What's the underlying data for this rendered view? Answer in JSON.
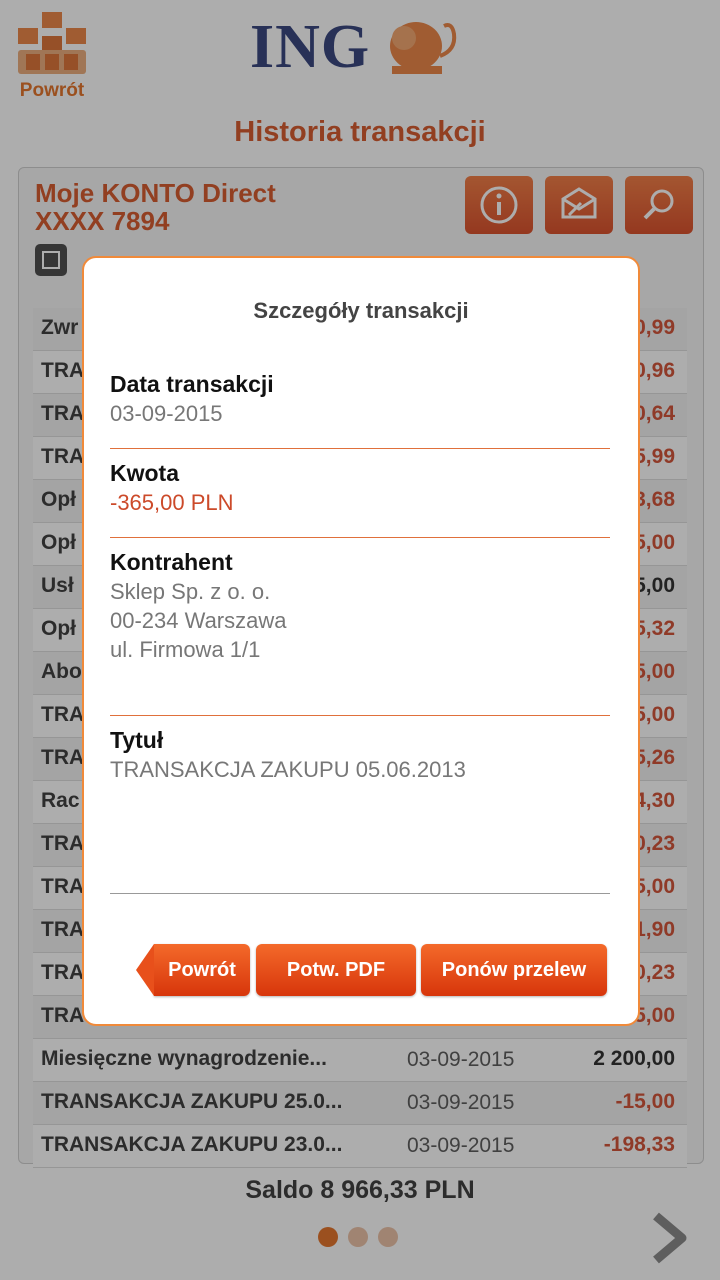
{
  "header": {
    "back_label": "Powrót",
    "logo_text": "ING"
  },
  "page_title": "Historia transakcji",
  "account": {
    "name": "Moje KONTO Direct",
    "number": "XXXX 7894"
  },
  "transactions": [
    {
      "title": "Zwr",
      "date": "",
      "amount": "0,99",
      "type": "neg"
    },
    {
      "title": "TRA",
      "date": "",
      "amount": "0,96",
      "type": "neg"
    },
    {
      "title": "TRA",
      "date": "",
      "amount": "0,64",
      "type": "neg"
    },
    {
      "title": "TRA",
      "date": "",
      "amount": "5,99",
      "type": "neg"
    },
    {
      "title": "Opł",
      "date": "",
      "amount": "3,68",
      "type": "neg"
    },
    {
      "title": "Opł",
      "date": "",
      "amount": "5,00",
      "type": "neg"
    },
    {
      "title": "Usł",
      "date": "",
      "amount": "5,00",
      "type": "pos"
    },
    {
      "title": "Opł",
      "date": "",
      "amount": "5,32",
      "type": "neg"
    },
    {
      "title": "Abo",
      "date": "",
      "amount": "5,00",
      "type": "neg"
    },
    {
      "title": "TRA",
      "date": "",
      "amount": "5,00",
      "type": "neg"
    },
    {
      "title": "TRA",
      "date": "",
      "amount": "5,26",
      "type": "neg"
    },
    {
      "title": "Rac",
      "date": "",
      "amount": "4,30",
      "type": "neg"
    },
    {
      "title": "TRA",
      "date": "",
      "amount": "0,23",
      "type": "neg"
    },
    {
      "title": "TRA",
      "date": "",
      "amount": "5,00",
      "type": "neg"
    },
    {
      "title": "TRA",
      "date": "",
      "amount": "1,90",
      "type": "neg"
    },
    {
      "title": "TRA",
      "date": "",
      "amount": "0,23",
      "type": "neg"
    },
    {
      "title": "TRA",
      "date": "",
      "amount": "5,00",
      "type": "neg"
    },
    {
      "title": "Miesięczne wynagrodzenie...",
      "date": "03-09-2015",
      "amount": "2 200,00",
      "type": "pos"
    },
    {
      "title": "TRANSAKCJA ZAKUPU 25.0...",
      "date": "03-09-2015",
      "amount": "-15,00",
      "type": "neg"
    },
    {
      "title": "TRANSAKCJA ZAKUPU 23.0...",
      "date": "03-09-2015",
      "amount": "-198,33",
      "type": "neg"
    }
  ],
  "balance": "Saldo 8 966,33 PLN",
  "modal": {
    "title": "Szczegóły transakcji",
    "date_label": "Data transakcji",
    "date_value": "03-09-2015",
    "amount_label": "Kwota",
    "amount_value": "-365,00 PLN",
    "counterparty_label": "Kontrahent",
    "counterparty_lines": [
      "Sklep Sp. z o. o.",
      "00-234 Warszawa",
      "ul. Firmowa 1/1"
    ],
    "title_label": "Tytuł",
    "title_value": "TRANSAKCJA ZAKUPU 05.06.2013",
    "buttons": {
      "back": "Powrót",
      "pdf": "Potw. PDF",
      "repeat": "Ponów przelew"
    }
  },
  "colors": {
    "accent": "#e0600b",
    "brand_blue": "#1a2a6c",
    "negative": "#cc3a1a"
  }
}
